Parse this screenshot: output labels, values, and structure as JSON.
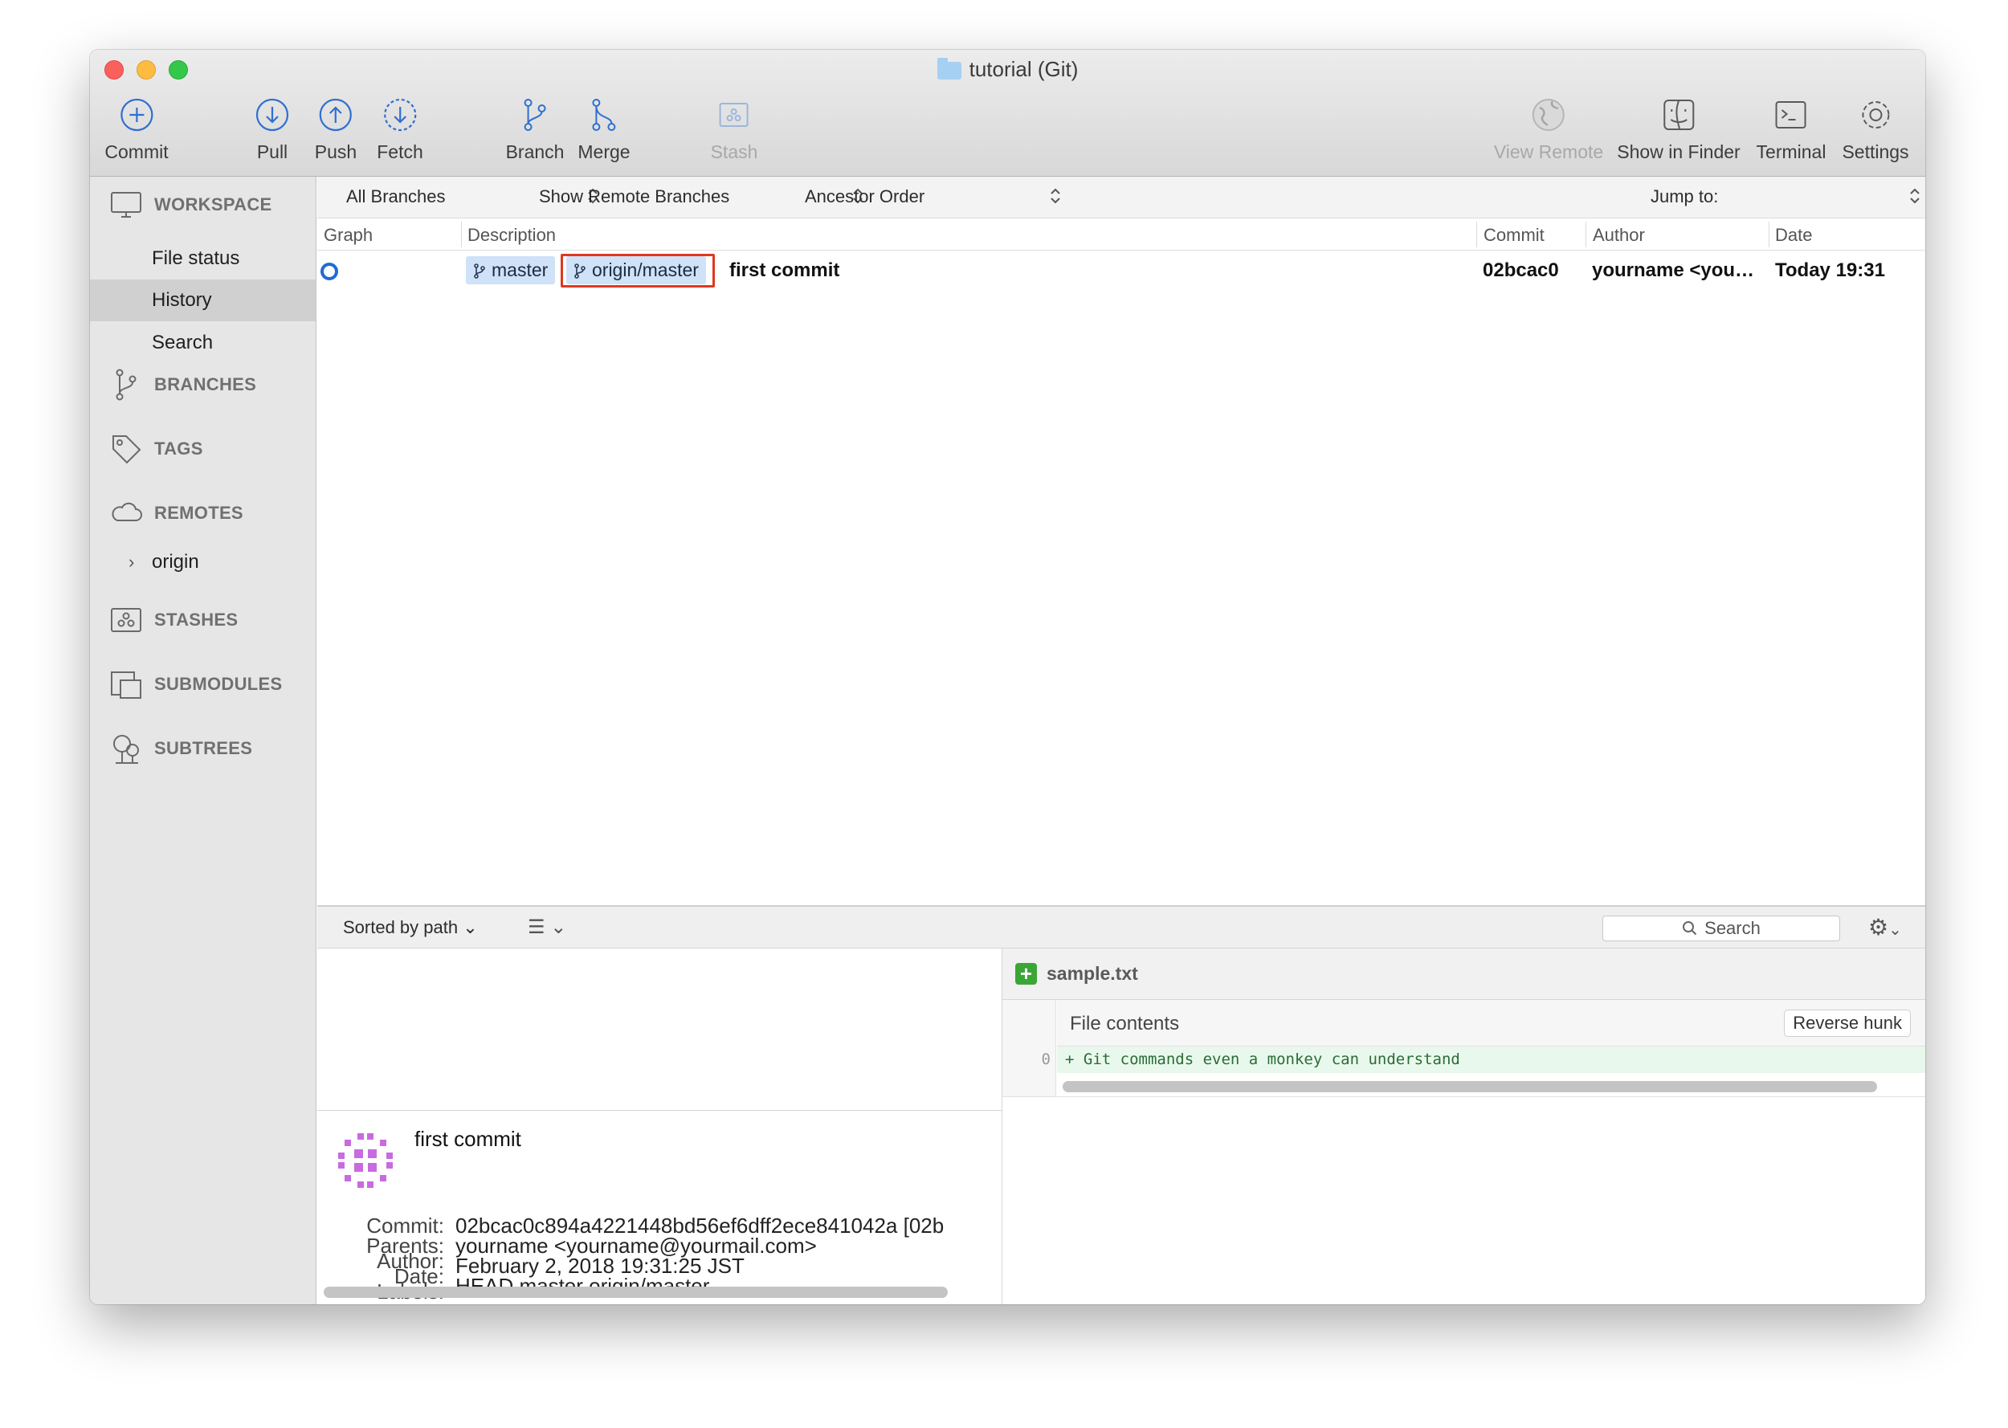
{
  "window": {
    "title": "tutorial (Git)"
  },
  "toolbar": {
    "commit": "Commit",
    "pull": "Pull",
    "push": "Push",
    "fetch": "Fetch",
    "branch": "Branch",
    "merge": "Merge",
    "stash": "Stash",
    "view_remote": "View Remote",
    "show_in_finder": "Show in Finder",
    "terminal": "Terminal",
    "settings": "Settings"
  },
  "sidebar": {
    "workspace": "WORKSPACE",
    "items": [
      "File status",
      "History",
      "Search"
    ],
    "selected": "History",
    "branches": "BRANCHES",
    "tags": "TAGS",
    "remotes": "REMOTES",
    "remote_origin": "origin",
    "stashes": "STASHES",
    "submodules": "SUBMODULES",
    "subtrees": "SUBTREES"
  },
  "filters": {
    "branches": "All Branches",
    "remote": "Show Remote Branches",
    "order": "Ancestor Order",
    "jump_to": "Jump to:"
  },
  "columns": {
    "graph": "Graph",
    "description": "Description",
    "commit": "Commit",
    "author": "Author",
    "date": "Date"
  },
  "commits": [
    {
      "branch_local": "master",
      "branch_remote": "origin/master",
      "message": "first commit",
      "hash": "02bcac0",
      "author": "yourname <you…",
      "date": "Today 19:31"
    }
  ],
  "lower": {
    "sort": "Sorted by path",
    "search_placeholder": "Search"
  },
  "details": {
    "message": "first commit",
    "labels": {
      "commit": "Commit:",
      "parents": "Parents:",
      "author": "Author:",
      "date": "Date:",
      "labels": "Labels:"
    },
    "commit_value": "02bcac0c894a4221448bd56ef6dff2ece841042a [02b",
    "author_value": "yourname <yourname@yourmail.com>",
    "date_value": "February 2, 2018 19:31:25 JST",
    "labels_value": "HEAD master origin/master"
  },
  "diff": {
    "filename": "sample.txt",
    "hunk_title": "File contents",
    "reverse_hunk": "Reverse hunk",
    "line_number": "0",
    "line": "+ Git commands even a monkey can understand"
  },
  "colors": {
    "accent": "#1f6bd6",
    "highlight_border": "#e0381f",
    "added": "#3ba635",
    "tag_bg": "#cfe2f7"
  }
}
